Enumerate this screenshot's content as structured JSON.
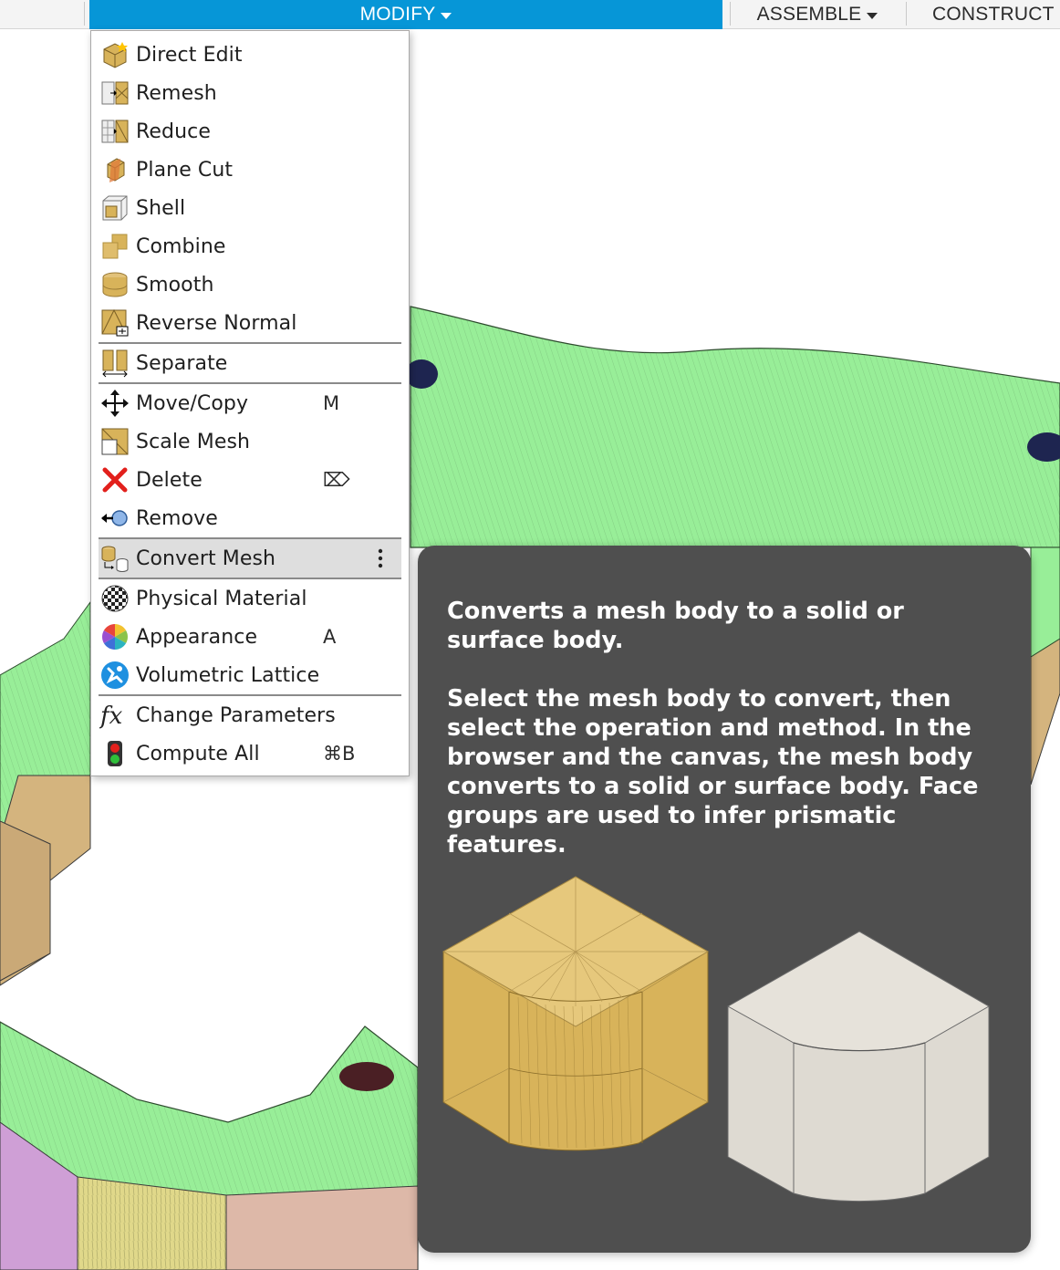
{
  "toolbar": {
    "tabs": [
      {
        "label": "MODIFY",
        "active": true
      },
      {
        "label": "ASSEMBLE",
        "active": false
      },
      {
        "label": "CONSTRUCT",
        "active": false
      }
    ]
  },
  "menu": {
    "items": [
      {
        "label": "Direct Edit",
        "icon": "direct-edit-icon",
        "shortcut": ""
      },
      {
        "label": "Remesh",
        "icon": "remesh-icon",
        "shortcut": ""
      },
      {
        "label": "Reduce",
        "icon": "reduce-icon",
        "shortcut": ""
      },
      {
        "label": "Plane Cut",
        "icon": "plane-cut-icon",
        "shortcut": ""
      },
      {
        "label": "Shell",
        "icon": "shell-icon",
        "shortcut": ""
      },
      {
        "label": "Combine",
        "icon": "combine-icon",
        "shortcut": ""
      },
      {
        "label": "Smooth",
        "icon": "smooth-icon",
        "shortcut": ""
      },
      {
        "label": "Reverse Normal",
        "icon": "reverse-normal-icon",
        "shortcut": ""
      },
      {
        "label": "Separate",
        "icon": "separate-icon",
        "shortcut": ""
      },
      {
        "label": "Move/Copy",
        "icon": "move-arrows-icon",
        "shortcut": "M"
      },
      {
        "label": "Scale Mesh",
        "icon": "scale-mesh-icon",
        "shortcut": ""
      },
      {
        "label": "Delete",
        "icon": "delete-x-icon",
        "shortcut": "⌦"
      },
      {
        "label": "Remove",
        "icon": "remove-icon",
        "shortcut": ""
      },
      {
        "label": "Convert Mesh",
        "icon": "convert-mesh-icon",
        "shortcut": "",
        "highlighted": true
      },
      {
        "label": "Physical Material",
        "icon": "physical-material-icon",
        "shortcut": ""
      },
      {
        "label": "Appearance",
        "icon": "appearance-icon",
        "shortcut": "A"
      },
      {
        "label": "Volumetric Lattice",
        "icon": "volumetric-lattice-icon",
        "shortcut": ""
      },
      {
        "label": "Change Parameters",
        "icon": "change-parameters-icon",
        "shortcut": ""
      },
      {
        "label": "Compute All",
        "icon": "compute-all-icon",
        "shortcut": "⌘B"
      }
    ]
  },
  "tooltip": {
    "summary": "Converts a mesh body to a solid or surface body.",
    "description": "Select the mesh body to convert, then select the operation and method. In the browser and the canvas, the mesh body converts to a solid or surface body. Face groups are used to infer prismatic features."
  },
  "colors": {
    "accent": "#0696d7",
    "mesh_green": "#98ee98",
    "mesh_tan": "#d4b47e",
    "tooltip_bg": "#4f4f4f"
  }
}
